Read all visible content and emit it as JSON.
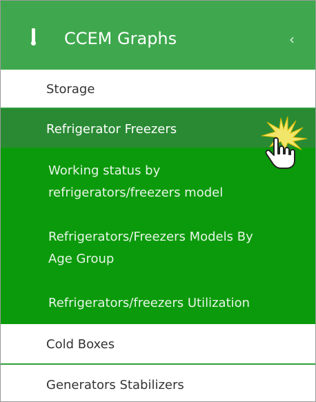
{
  "header": {
    "title": "CCEM Graphs",
    "icon": "thermometer-icon",
    "collapse_icon": "chevron-left-icon",
    "collapse_glyph": "‹",
    "background_color": "#3fa84e"
  },
  "menu": {
    "storage": "Storage",
    "refrigerator_freezers": "Refrigerator Freezers",
    "submenu": [
      {
        "line1": "Working status by",
        "line2": "refrigerators/freezers model"
      },
      {
        "line1": "Refrigerators/Freezers Models By",
        "line2": "Age Group"
      },
      {
        "line1": "Refrigerators/freezers Utilization",
        "line2": ""
      }
    ],
    "cold_boxes": "Cold Boxes",
    "generators_stabilizers": "Generators Stabilizers",
    "active_color": "#2a8a34",
    "submenu_color": "#0b9a0b"
  },
  "cursor": {
    "icon": "hand-pointer-click-icon"
  }
}
